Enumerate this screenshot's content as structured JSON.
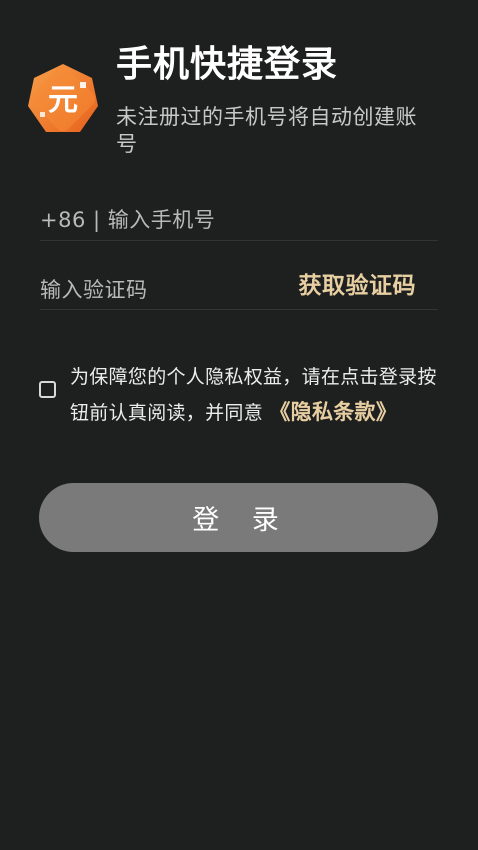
{
  "header": {
    "logo_icon": "app-logo-icon",
    "logo_glyph": "元",
    "title": "手机快捷登录",
    "subtitle": "未注册过的手机号将自动创建账号"
  },
  "form": {
    "phone_prefix": "+86",
    "phone_placeholder": "输入手机号",
    "code_placeholder": "输入验证码",
    "get_code_label": "获取验证码"
  },
  "agreement": {
    "checked": false,
    "text_line1": "为保障您的个人隐私权益，请在点击登录按",
    "text_line2": "钮前认真阅读，并同意",
    "link_label": "《隐私条款》"
  },
  "login_button": {
    "label": "登 录"
  },
  "colors": {
    "background": "#1e1f1f",
    "accent": "#e7cfa2",
    "button": "#7a7a7a",
    "logo_orange": "#f07a26"
  }
}
